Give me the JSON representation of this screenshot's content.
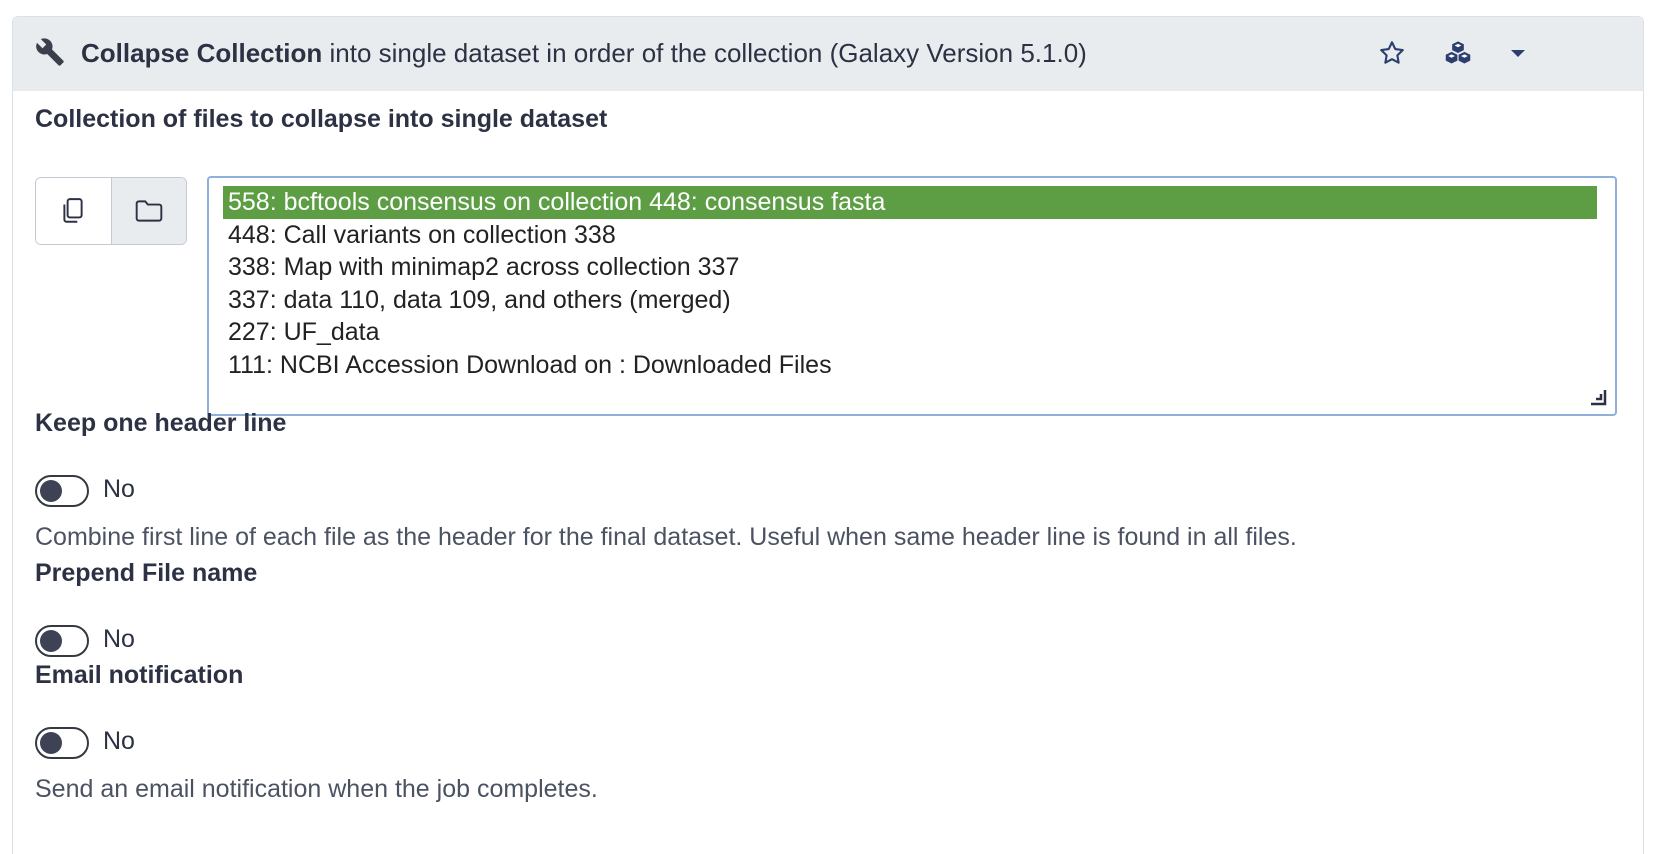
{
  "tool": {
    "name": "Collapse Collection",
    "description": "into single dataset in order of the collection (Galaxy Version 5.1.0)",
    "header_icons": [
      "wrench-icon",
      "star-icon",
      "cubes-icon",
      "caret-down-icon"
    ]
  },
  "collection": {
    "label": "Collection of files to collapse into single dataset",
    "source_buttons": [
      "copy-icon",
      "folder-icon"
    ],
    "options": [
      "558: bcftools consensus on collection 448: consensus fasta",
      "448: Call variants on collection 338",
      "338: Map with minimap2 across collection 337",
      "337: data 110, data 109, and others (merged)",
      "227: UF_data",
      "111: NCBI Accession Download on : Downloaded Files"
    ],
    "selected_index": 0,
    "selected_color": "#5d9e45"
  },
  "params": [
    {
      "label": "Keep one header line",
      "toggle_value": "No",
      "checked": false,
      "help": "Combine first line of each file as the header for the final dataset. Useful when same header line is found in all files."
    },
    {
      "label": "Prepend File name",
      "toggle_value": "No",
      "checked": false,
      "help": ""
    },
    {
      "label": "Email notification",
      "toggle_value": "No",
      "checked": false,
      "help": "Send an email notification when the job completes."
    }
  ]
}
